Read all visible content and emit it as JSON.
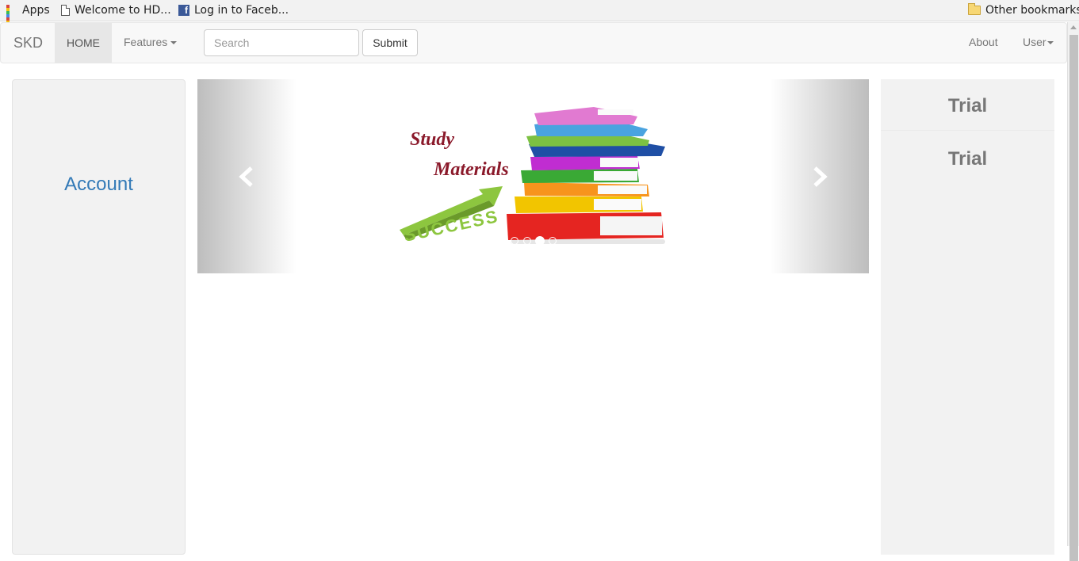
{
  "bookmarks_bar": {
    "items": [
      {
        "label": "Apps",
        "icon": "apps-grid-icon"
      },
      {
        "label": "Welcome to HD...",
        "icon": "page-icon"
      },
      {
        "label": "Log in to Faceb...",
        "icon": "facebook-icon"
      }
    ],
    "other": {
      "label": "Other bookmarks",
      "icon": "folder-icon"
    }
  },
  "navbar": {
    "brand": "SKD",
    "home": "HOME",
    "features": "Features",
    "search": {
      "placeholder": "Search",
      "value": ""
    },
    "submit": "Submit",
    "about": "About",
    "user": "User"
  },
  "left_panel": {
    "account": "Account"
  },
  "carousel": {
    "slide_text": {
      "line1": "Study",
      "line2": "Materials",
      "badge": "SUCCESS"
    },
    "indicator_count": 4,
    "active_index": 2,
    "prev_icon": "chevron-left-icon",
    "next_icon": "chevron-right-icon"
  },
  "right_panel": {
    "items": [
      "Trial",
      "Trial"
    ]
  },
  "colors": {
    "link_blue": "#337ab7",
    "title_maroon": "#8b1a2b",
    "success_green": "#8dc63f",
    "panel_gray": "#f2f2f2"
  }
}
